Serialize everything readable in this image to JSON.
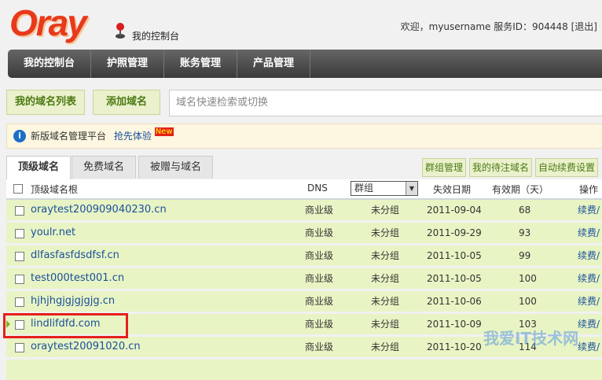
{
  "header": {
    "logo": "Oray",
    "console": "我的控制台",
    "welcome": "欢迎，myusername 服务ID：904448 [退出]"
  },
  "nav": [
    "我的控制台",
    "护照管理",
    "账务管理",
    "产品管理"
  ],
  "actions": {
    "list": "我的域名列表",
    "add": "添加域名",
    "search_placeholder": "域名快速检索或切换"
  },
  "notice": {
    "text": "新版域名管理平台",
    "link": "抢先体验",
    "badge": "New"
  },
  "tabs": [
    "顶级域名",
    "免费域名",
    "被赠与域名"
  ],
  "side_buttons": [
    "群组管理",
    "我的待注域名",
    "自动续费设置"
  ],
  "table": {
    "headers": {
      "name": "顶级域名根",
      "dns": "DNS",
      "group": "群组",
      "expire": "失效日期",
      "days": "有效期（天）",
      "op": "操作"
    },
    "rows": [
      {
        "name": "oraytest200909040230.cn",
        "dns": "商业级",
        "group": "未分组",
        "expire": "2011-09-04",
        "days": "68",
        "op": "续费/"
      },
      {
        "name": "youlr.net",
        "dns": "商业级",
        "group": "未分组",
        "expire": "2011-09-29",
        "days": "93",
        "op": "续费/"
      },
      {
        "name": "dlfasfasfdsdfsf.cn",
        "dns": "商业级",
        "group": "未分组",
        "expire": "2011-10-05",
        "days": "99",
        "op": "续费/"
      },
      {
        "name": "test000test001.cn",
        "dns": "商业级",
        "group": "未分组",
        "expire": "2011-10-05",
        "days": "100",
        "op": "续费/"
      },
      {
        "name": "hjhjhgjgjgjgjg.cn",
        "dns": "商业级",
        "group": "未分组",
        "expire": "2011-10-06",
        "days": "100",
        "op": "续费/"
      },
      {
        "name": "lindlifdfd.com",
        "dns": "商业级",
        "group": "未分组",
        "expire": "2011-10-09",
        "days": "103",
        "op": "续费/"
      },
      {
        "name": "oraytest20091020.cn",
        "dns": "商业级",
        "group": "未分组",
        "expire": "2011-10-20",
        "days": "114",
        "op": "续费/"
      }
    ]
  },
  "watermark": "我爱IT技术网"
}
